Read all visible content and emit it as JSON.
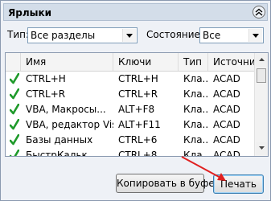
{
  "panel": {
    "title": "Ярлыки"
  },
  "filters": {
    "type_label": "Тип:",
    "type_value": "Все разделы",
    "state_label": "Состояние:",
    "state_value": "Все"
  },
  "table": {
    "columns": [
      "Имя",
      "Ключи",
      "Тип",
      "Источник"
    ],
    "rows": [
      {
        "name": "CTRL+H",
        "keys": "CTRL+H",
        "type": "Кла...",
        "source": "ACAD"
      },
      {
        "name": "CTRL+R",
        "keys": "CTRL+R",
        "type": "Кла...",
        "source": "ACAD"
      },
      {
        "name": "VBA, Макросы...",
        "keys": "ALT+F8",
        "type": "Кла...",
        "source": "ACAD"
      },
      {
        "name": "VBA, редактор Vis...",
        "keys": "ALT+F11",
        "type": "Кла...",
        "source": "ACAD"
      },
      {
        "name": "Базы данных",
        "keys": "CTRL+6",
        "type": "Кла...",
        "source": "ACAD"
      },
      {
        "name": "БыстрКальк",
        "keys": "CTRL+8",
        "type": "Кла...",
        "source": "ACAD"
      }
    ]
  },
  "buttons": {
    "copy": "Копировать в буфер",
    "print": "Печать"
  },
  "colors": {
    "check": "#1e9a2a",
    "annotation_arrow": "#e02020"
  }
}
